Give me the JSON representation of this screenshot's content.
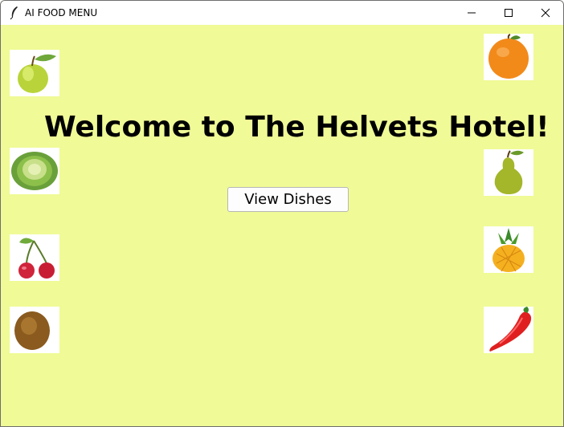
{
  "window": {
    "title": "AI FOOD MENU",
    "background_color": "#f0fa96",
    "controls": {
      "minimize_icon": "minimize-icon",
      "maximize_icon": "maximize-icon",
      "close_icon": "close-icon"
    }
  },
  "main": {
    "heading": "Welcome to The Helvets Hotel!",
    "view_button_label": "View Dishes"
  },
  "left_images": [
    "apple-image",
    "cabbage-image",
    "cherries-image",
    "kiwi-image"
  ],
  "right_images": [
    "orange-image",
    "pear-image",
    "pineapple-image",
    "chili-pepper-image"
  ]
}
